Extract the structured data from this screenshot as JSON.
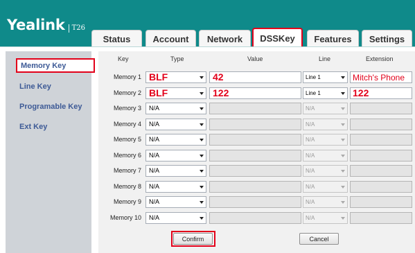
{
  "header": {
    "brand": "Yealink",
    "model": "T26",
    "tabs": [
      "Status",
      "Account",
      "Network",
      "DSSKey",
      "Features",
      "Settings"
    ],
    "active_tab": "DSSKey",
    "accent_color": "#e2001a",
    "header_color": "#0f8a8a"
  },
  "sidebar": {
    "items": [
      "Memory Key",
      "Line Key",
      "Programable Key",
      "Ext Key"
    ],
    "active": "Memory Key"
  },
  "table": {
    "columns": [
      "Key",
      "Type",
      "Value",
      "Line",
      "Extension"
    ],
    "rows": [
      {
        "key": "Memory 1",
        "type": "BLF",
        "value": "42",
        "line": "Line 1",
        "extension": "Mitch's Phone"
      },
      {
        "key": "Memory 2",
        "type": "BLF",
        "value": "122",
        "line": "Line 1",
        "extension": "122"
      },
      {
        "key": "Memory 3",
        "type": "N/A",
        "value": "",
        "line": "N/A",
        "extension": ""
      },
      {
        "key": "Memory 4",
        "type": "N/A",
        "value": "",
        "line": "N/A",
        "extension": ""
      },
      {
        "key": "Memory 5",
        "type": "N/A",
        "value": "",
        "line": "N/A",
        "extension": ""
      },
      {
        "key": "Memory 6",
        "type": "N/A",
        "value": "",
        "line": "N/A",
        "extension": ""
      },
      {
        "key": "Memory 7",
        "type": "N/A",
        "value": "",
        "line": "N/A",
        "extension": ""
      },
      {
        "key": "Memory 8",
        "type": "N/A",
        "value": "",
        "line": "N/A",
        "extension": ""
      },
      {
        "key": "Memory 9",
        "type": "N/A",
        "value": "",
        "line": "N/A",
        "extension": ""
      },
      {
        "key": "Memory 10",
        "type": "N/A",
        "value": "",
        "line": "N/A",
        "extension": ""
      }
    ]
  },
  "buttons": {
    "confirm": "Confirm",
    "cancel": "Cancel"
  }
}
